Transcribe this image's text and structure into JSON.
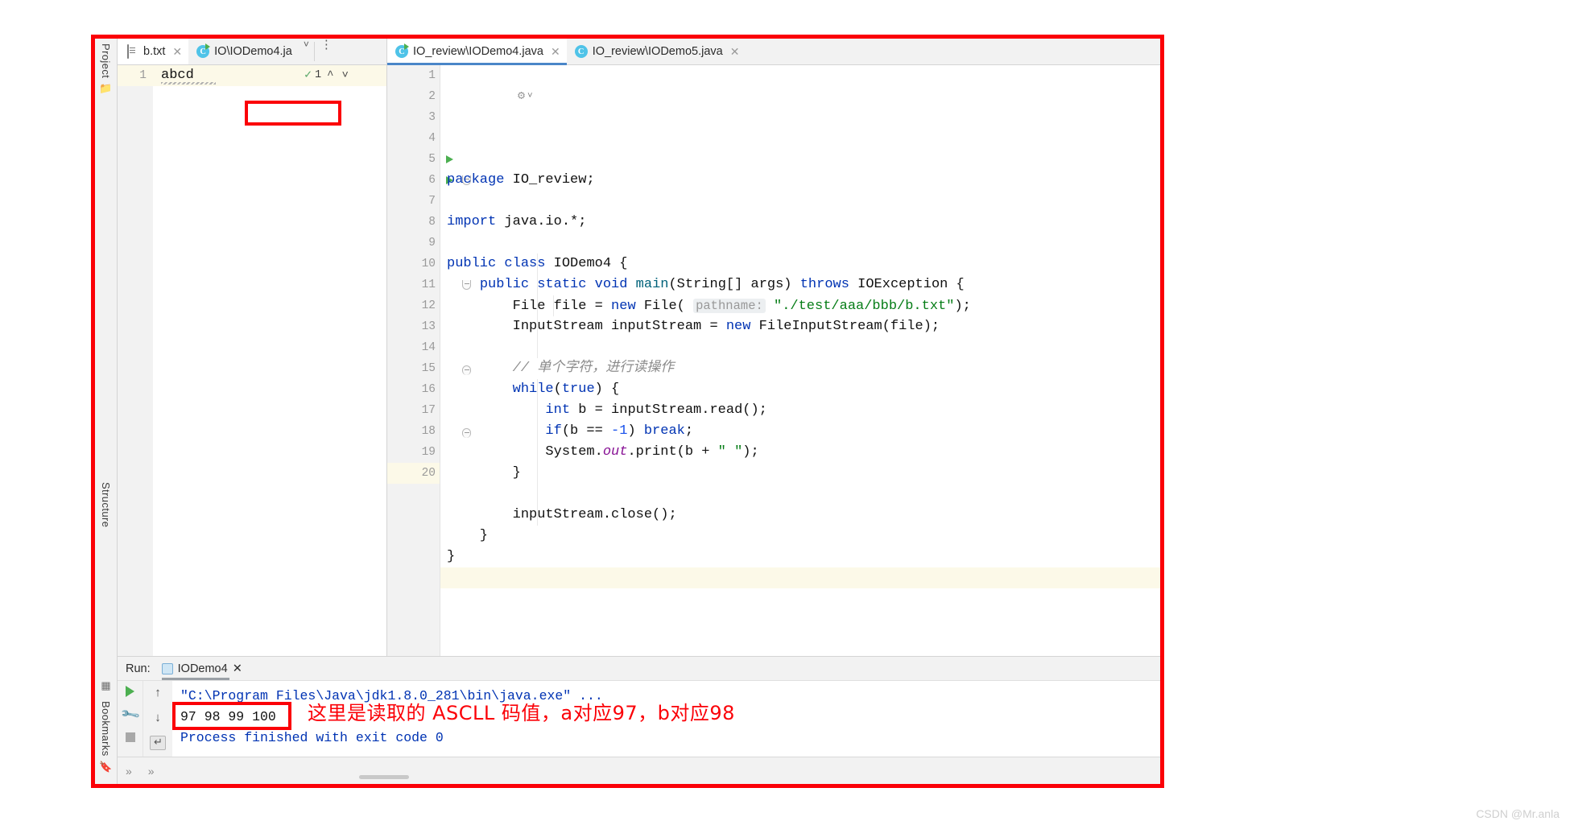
{
  "colors": {
    "annotation_red": "#fb0007",
    "keyword_blue": "#0033b3",
    "string_green": "#067d17",
    "comment_gray": "#8c8c8c",
    "console_blue": "#0033b3",
    "tab_active_underline": "#4a86c8"
  },
  "tool_strip": {
    "project_label": "Project",
    "structure_label": "Structure",
    "bookmarks_label": "Bookmarks"
  },
  "left_pane": {
    "tabs": [
      {
        "label": "b.txt",
        "icon": "text-file-icon",
        "active": true,
        "closable": true
      },
      {
        "label": "IO\\IODemo4.ja",
        "icon": "java-class-run-icon",
        "active": false,
        "closable": false
      }
    ],
    "chevron_icon": "chevron-down-icon",
    "kebab_icon": "more-options-icon",
    "line_numbers": [
      "1"
    ],
    "content_line": "abcd",
    "inspection": {
      "icon": "inspection-check-icon",
      "count": "1",
      "prev_icon": "caret-up-icon",
      "next_icon": "caret-down-icon"
    }
  },
  "editor": {
    "tabs": [
      {
        "label": "IO_review\\IODemo4.java",
        "icon": "java-class-run-icon",
        "active": true
      },
      {
        "label": "IO_review\\IODemo5.java",
        "icon": "java-class-icon",
        "active": false
      }
    ],
    "gutter_hint_icon": "intention-bulb-icon",
    "lines": [
      {
        "n": "1",
        "html": "<span class=\"kw\">package</span> IO_review;"
      },
      {
        "n": "2",
        "html": ""
      },
      {
        "n": "3",
        "html": "<span class=\"kw\">import</span> java.io.*;"
      },
      {
        "n": "4",
        "html": ""
      },
      {
        "n": "5",
        "html": "<span class=\"kw\">public</span> <span class=\"kw\">class</span> IODemo4 {",
        "run_marker": true
      },
      {
        "n": "6",
        "html": "    <span class=\"kw\">public</span> <span class=\"kw\">static</span> <span class=\"kw\">void</span> <span class=\"meth\">main</span>(String[] args) <span class=\"kw\">throws</span> IOException {",
        "run_marker": true,
        "fold": "down"
      },
      {
        "n": "7",
        "html": "        File file = <span class=\"kw\">new</span> File( <span class=\"hint\">pathname:</span> <span class=\"str\">\"./test/aaa/bbb/b.txt\"</span>);"
      },
      {
        "n": "8",
        "html": "        InputStream inputStream = <span class=\"kw\">new</span> FileInputStream(file);"
      },
      {
        "n": "9",
        "html": ""
      },
      {
        "n": "10",
        "html": "        <span class=\"cmt\">// 单个字符，进行读操作</span>"
      },
      {
        "n": "11",
        "html": "        <span class=\"kw\">while</span>(<span class=\"kw\">true</span>) {",
        "fold": "down"
      },
      {
        "n": "12",
        "html": "            <span class=\"kw\">int</span> b = inputStream.read();"
      },
      {
        "n": "13",
        "html": "            <span class=\"kw\">if</span>(b == <span class=\"num\">-1</span>) <span class=\"kw\">break</span>;"
      },
      {
        "n": "14",
        "html": "            System.<span class=\"field\">out</span>.print(b + <span class=\"str\">\" \"</span>);"
      },
      {
        "n": "15",
        "html": "        }",
        "fold": "up"
      },
      {
        "n": "16",
        "html": ""
      },
      {
        "n": "17",
        "html": "        inputStream.close();"
      },
      {
        "n": "18",
        "html": "    }",
        "fold": "up"
      },
      {
        "n": "19",
        "html": "}"
      },
      {
        "n": "20",
        "html": "",
        "highlight": true
      }
    ]
  },
  "run_panel": {
    "run_label": "Run:",
    "config_name": "IODemo4",
    "config_icon": "run-config-icon",
    "close_icon": "close-icon",
    "toolbar": [
      {
        "name": "rerun-button",
        "icon": "play-icon"
      },
      {
        "name": "soft-wrap-button",
        "icon": "wrench-icon"
      },
      {
        "name": "stop-button",
        "icon": "stop-icon"
      }
    ],
    "toolbar_secondary": [
      {
        "name": "scroll-up-button",
        "icon": "arrow-up-icon"
      },
      {
        "name": "scroll-down-button",
        "icon": "arrow-down-icon"
      },
      {
        "name": "print-button",
        "icon": "print-icon"
      }
    ],
    "console": {
      "command_line": "\"C:\\Program Files\\Java\\jdk1.8.0_281\\bin\\java.exe\" ...",
      "output_line": "97 98 99 100",
      "exit_line": "Process finished with exit code 0"
    }
  },
  "annotations": {
    "output_note": "这里是读取的 ASCLL 码值，a对应97，b对应98"
  },
  "status_bar": {
    "expand_icon": "chevron-double-right-icon",
    "expand_icon_2": "chevron-double-right-icon"
  },
  "watermark": {
    "text": "CSDN @Mr.anla"
  }
}
